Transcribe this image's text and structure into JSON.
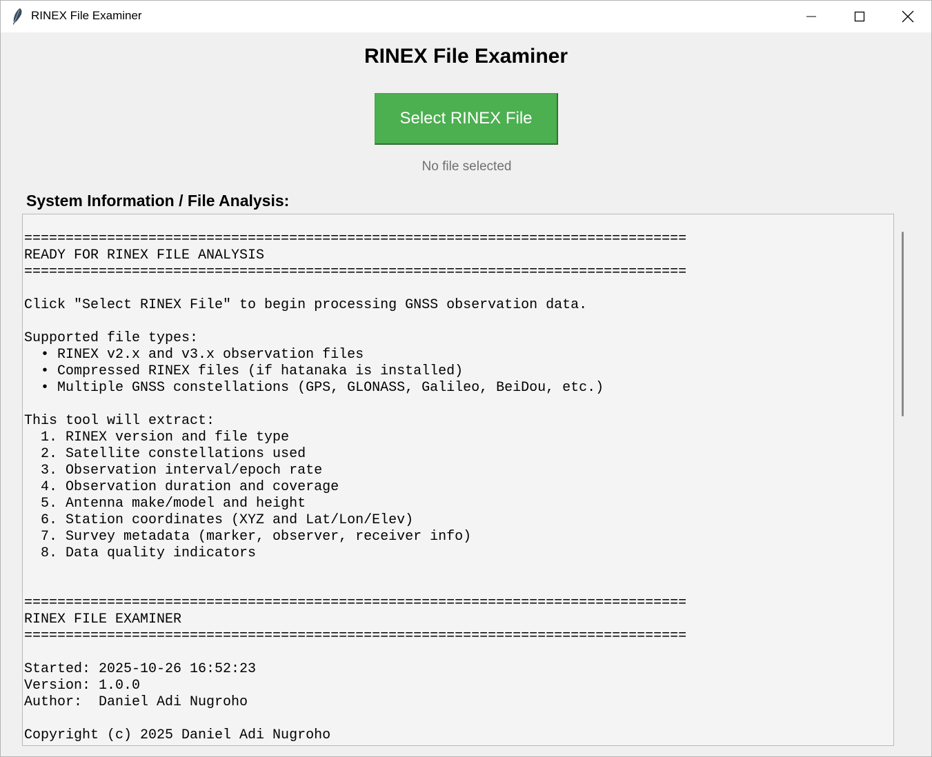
{
  "window": {
    "title": "RINEX File Examiner",
    "app_icon": "feather-icon"
  },
  "header": {
    "title": "RINEX File Examiner"
  },
  "actions": {
    "select_label": "Select RINEX File",
    "file_status": "No file selected"
  },
  "output": {
    "label": "System Information / File Analysis:",
    "lines": [
      "================================================================================",
      "READY FOR RINEX FILE ANALYSIS",
      "================================================================================",
      "",
      "Click \"Select RINEX File\" to begin processing GNSS observation data.",
      "",
      "Supported file types:",
      "  • RINEX v2.x and v3.x observation files",
      "  • Compressed RINEX files (if hatanaka is installed)",
      "  • Multiple GNSS constellations (GPS, GLONASS, Galileo, BeiDou, etc.)",
      "",
      "This tool will extract:",
      "  1. RINEX version and file type",
      "  2. Satellite constellations used",
      "  3. Observation interval/epoch rate",
      "  4. Observation duration and coverage",
      "  5. Antenna make/model and height",
      "  6. Station coordinates (XYZ and Lat/Lon/Elev)",
      "  7. Survey metadata (marker, observer, receiver info)",
      "  8. Data quality indicators",
      "",
      "",
      "================================================================================",
      "RINEX FILE EXAMINER",
      "================================================================================",
      "",
      "Started: 2025-10-26 16:52:23",
      "Version: 1.0.0",
      "Author:  Daniel Adi Nugroho",
      "",
      "Copyright (c) 2025 Daniel Adi Nugroho"
    ]
  }
}
